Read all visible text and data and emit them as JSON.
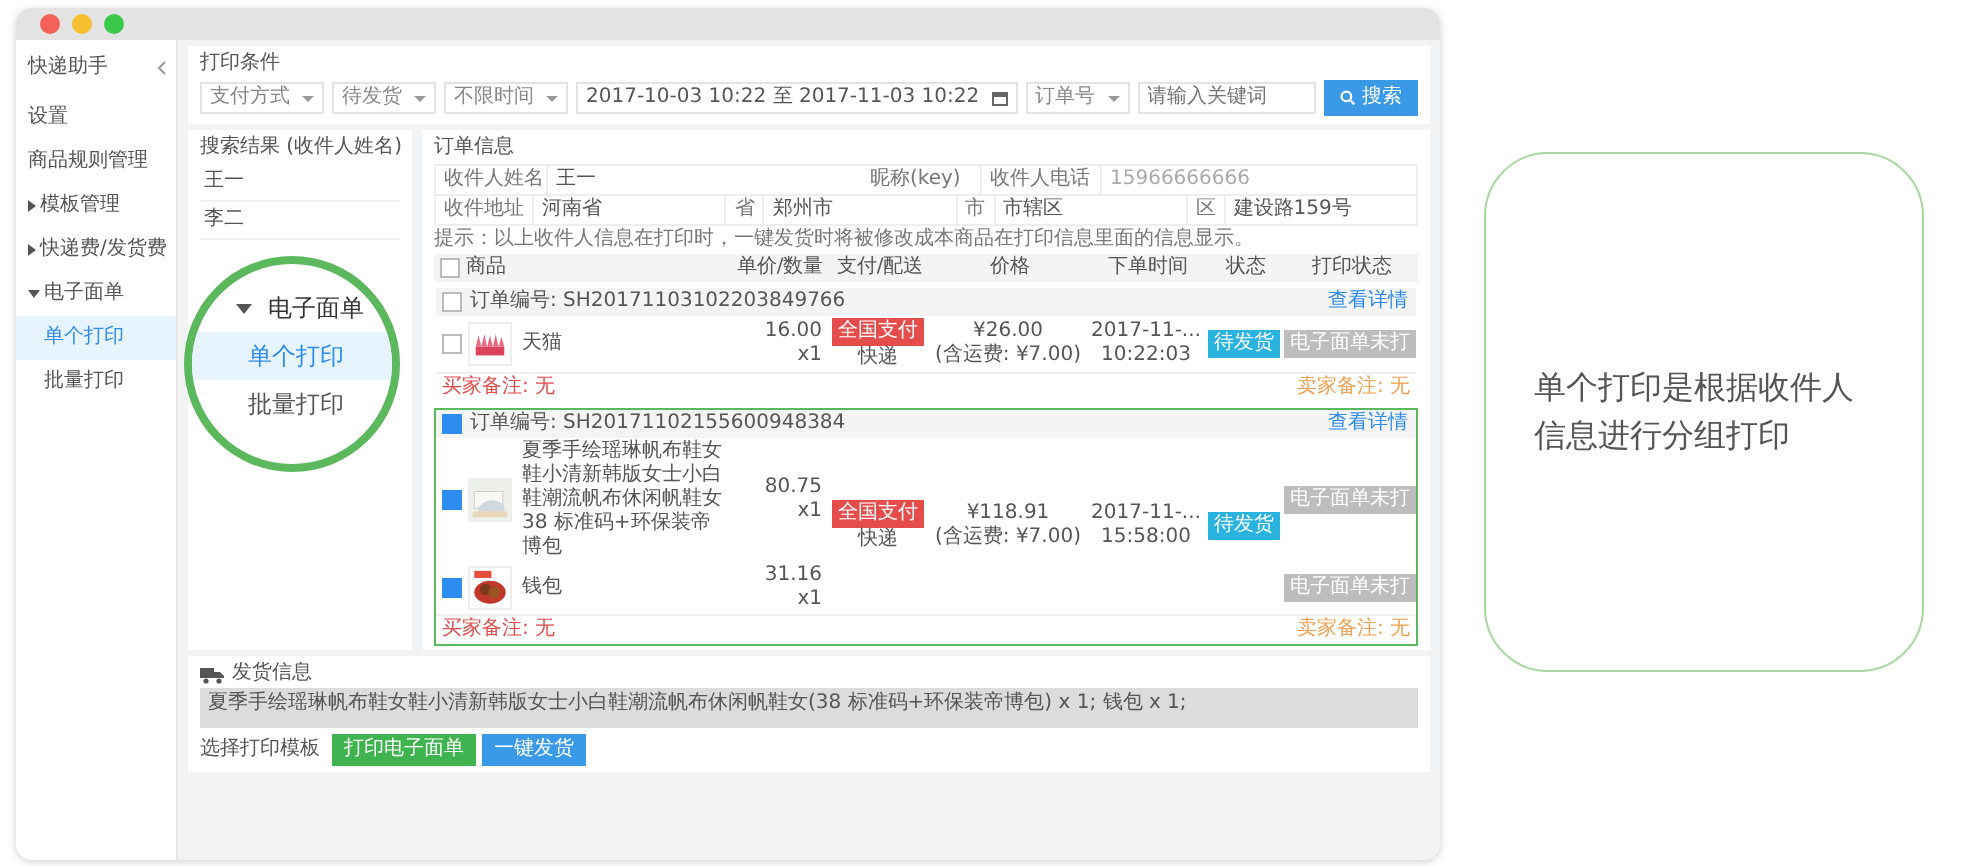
{
  "sidebar": {
    "title": "快递助手",
    "items": [
      {
        "label": "设置",
        "kind": "link",
        "selected": false
      },
      {
        "label": "商品规则管理",
        "kind": "link",
        "selected": false
      },
      {
        "label": "模板管理",
        "kind": "group",
        "selected": false,
        "expanded": false
      },
      {
        "label": "快递费/发货费",
        "kind": "group",
        "selected": false,
        "expanded": false
      },
      {
        "label": "电子面单",
        "kind": "group",
        "selected": false,
        "expanded": true,
        "children": [
          {
            "label": "单个打印",
            "selected": true
          },
          {
            "label": "批量打印",
            "selected": false
          }
        ]
      }
    ]
  },
  "filters": {
    "title": "打印条件",
    "selects": [
      "支付方式",
      "待发货",
      "不限时间"
    ],
    "date_range": "2017-10-03 10:22 至 2017-11-03 10:22",
    "field_select": "订单号",
    "search": {
      "placeholder": "请输入关键词"
    },
    "search_button": "搜索"
  },
  "results": {
    "title": "搜索结果 (收件人姓名)",
    "items": [
      "王一",
      "李二"
    ]
  },
  "order_info": {
    "title": "订单信息",
    "name_label": "收件人姓名",
    "name": "王一",
    "nick_label": "昵称(key)",
    "phone_label": "收件人电话",
    "phone": "15966666666",
    "address_label": "收件地址",
    "address": [
      {
        "value": "河南省",
        "unit": "省"
      },
      {
        "value": "郑州市",
        "unit": "市"
      },
      {
        "value": "市辖区",
        "unit": "区"
      },
      {
        "value": "建设路159号"
      }
    ],
    "hint": "提示：以上收件人信息在打印时，一键发货时将被修改成本商品在打印信息里面的信息显示。",
    "select_all": false,
    "columns": [
      "商品",
      "单价/数量",
      "支付/配送",
      "价格",
      "下单时间",
      "状态",
      "打印状态"
    ],
    "orders": [
      {
        "number": "订单编号: SH20171103102203849766",
        "checked": false,
        "highlighted": false,
        "detail_link": "查看详情",
        "pay_badge": "全国支付",
        "delivery": "快递",
        "price": "¥26.00",
        "price_note": "(含运费: ¥7.00)",
        "date": "2017-11-...",
        "time": "10:22:03",
        "status": "待发货",
        "buyer_note": "买家备注: 无",
        "seller_note": "卖家备注: 无",
        "items": [
          {
            "name": "天猫",
            "unit_price": "16.00",
            "qty": "x1",
            "checked": false,
            "print_status": "电子面单未打"
          }
        ]
      },
      {
        "number": "订单编号: SH20171102155600948384",
        "checked": true,
        "highlighted": true,
        "detail_link": "查看详情",
        "pay_badge": "全国支付",
        "delivery": "快递",
        "price": "¥118.91",
        "price_note": "(含运费: ¥7.00)",
        "date": "2017-11-...",
        "time": "15:58:00",
        "status": "待发货",
        "buyer_note": "买家备注: 无",
        "seller_note": "卖家备注: 无",
        "items": [
          {
            "name": "夏季手绘瑶琳帆布鞋女鞋小清新韩版女士小白鞋潮流帆布休闲帆鞋女 38 标准码+环保装帝博包",
            "unit_price": "80.75",
            "qty": "x1",
            "checked": true,
            "print_status": "电子面单未打"
          },
          {
            "name": "钱包",
            "unit_price": "31.16",
            "qty": "x1",
            "checked": true,
            "print_status": "电子面单未打"
          }
        ]
      }
    ]
  },
  "shipping": {
    "title": "发货信息",
    "summary": "夏季手绘瑶琳帆布鞋女鞋小清新韩版女士小白鞋潮流帆布休闲帆鞋女(38 标准码+环保装帝博包) x 1; 钱包 x 1;",
    "template_label": "选择打印模板",
    "buttons": [
      {
        "label": "打印电子面单",
        "kind": "success"
      },
      {
        "label": "一键发货",
        "kind": "primary"
      }
    ]
  },
  "zoom_circle": {
    "title": "电子面单",
    "expanded": true,
    "items": [
      {
        "label": "单个打印",
        "selected": true
      },
      {
        "label": "批量打印",
        "selected": false
      }
    ]
  },
  "callout": {
    "text": "单个打印是根据收件人信息进行分组打印"
  }
}
